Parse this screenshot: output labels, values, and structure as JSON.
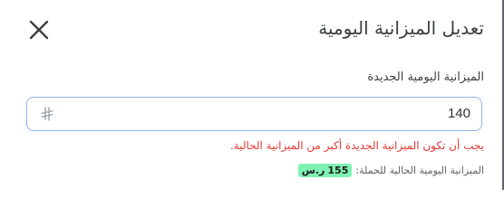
{
  "dialog": {
    "title": "تعديل الميزانية اليومية",
    "close_icon": "close-icon"
  },
  "budget_field": {
    "label": "الميزانية اليومية الجديدة",
    "value": "140",
    "currency_icon": "saudi-riyal-icon"
  },
  "error": {
    "message": "يجب أن تكون الميزانية الجديدة أكبر من الميزانية الحالية."
  },
  "current_budget": {
    "label": "الميزانية اليومية الحالية للحملة:",
    "amount": "155",
    "currency": "ر.س"
  },
  "colors": {
    "input_border": "#90b4e8",
    "error": "#e53935",
    "badge_bg": "#7ef2b2"
  }
}
